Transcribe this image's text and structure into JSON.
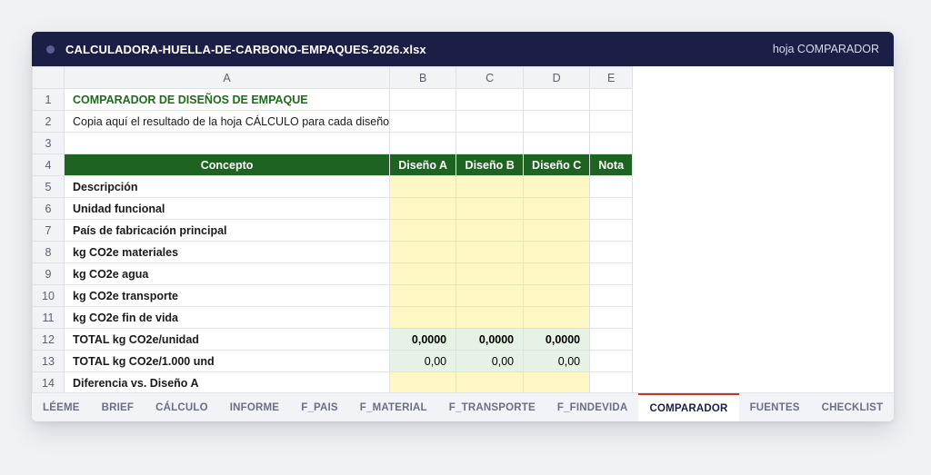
{
  "window": {
    "title": "CALCULADORA-HUELLA-DE-CARBONO-EMPAQUES-2026.xlsx",
    "sheet_label": "hoja COMPARADOR"
  },
  "columns": [
    "A",
    "B",
    "C",
    "D",
    "E"
  ],
  "rows": {
    "r1": "COMPARADOR DE DISEÑOS DE EMPAQUE",
    "r2": "Copia aquí el resultado de la hoja CÁLCULO para cada diseño",
    "header": [
      "Concepto",
      "Diseño A",
      "Diseño B",
      "Diseño C",
      "Nota"
    ],
    "concepts": [
      "Descripción",
      "Unidad funcional",
      "País de fabricación principal",
      "kg CO2e materiales",
      "kg CO2e agua",
      "kg CO2e transporte",
      "kg CO2e fin de vida",
      "TOTAL kg CO2e/unidad",
      "TOTAL kg CO2e/1.000 und",
      "Diferencia vs. Diseño A"
    ],
    "total_unit": [
      "0,0000",
      "0,0000",
      "0,0000"
    ],
    "total_thousand": [
      "0,00",
      "0,00",
      "0,00"
    ]
  },
  "row_numbers": [
    "1",
    "2",
    "3",
    "4",
    "5",
    "6",
    "7",
    "8",
    "9",
    "10",
    "11",
    "12",
    "13",
    "14"
  ],
  "tabs": [
    "LÉEME",
    "BRIEF",
    "CÁLCULO",
    "INFORME",
    "F_PAIS",
    "F_MATERIAL",
    "F_TRANSPORTE",
    "F_FINDEVIDA",
    "COMPARADOR",
    "FUENTES",
    "CHECKLIST"
  ],
  "active_tab": "COMPARADOR"
}
